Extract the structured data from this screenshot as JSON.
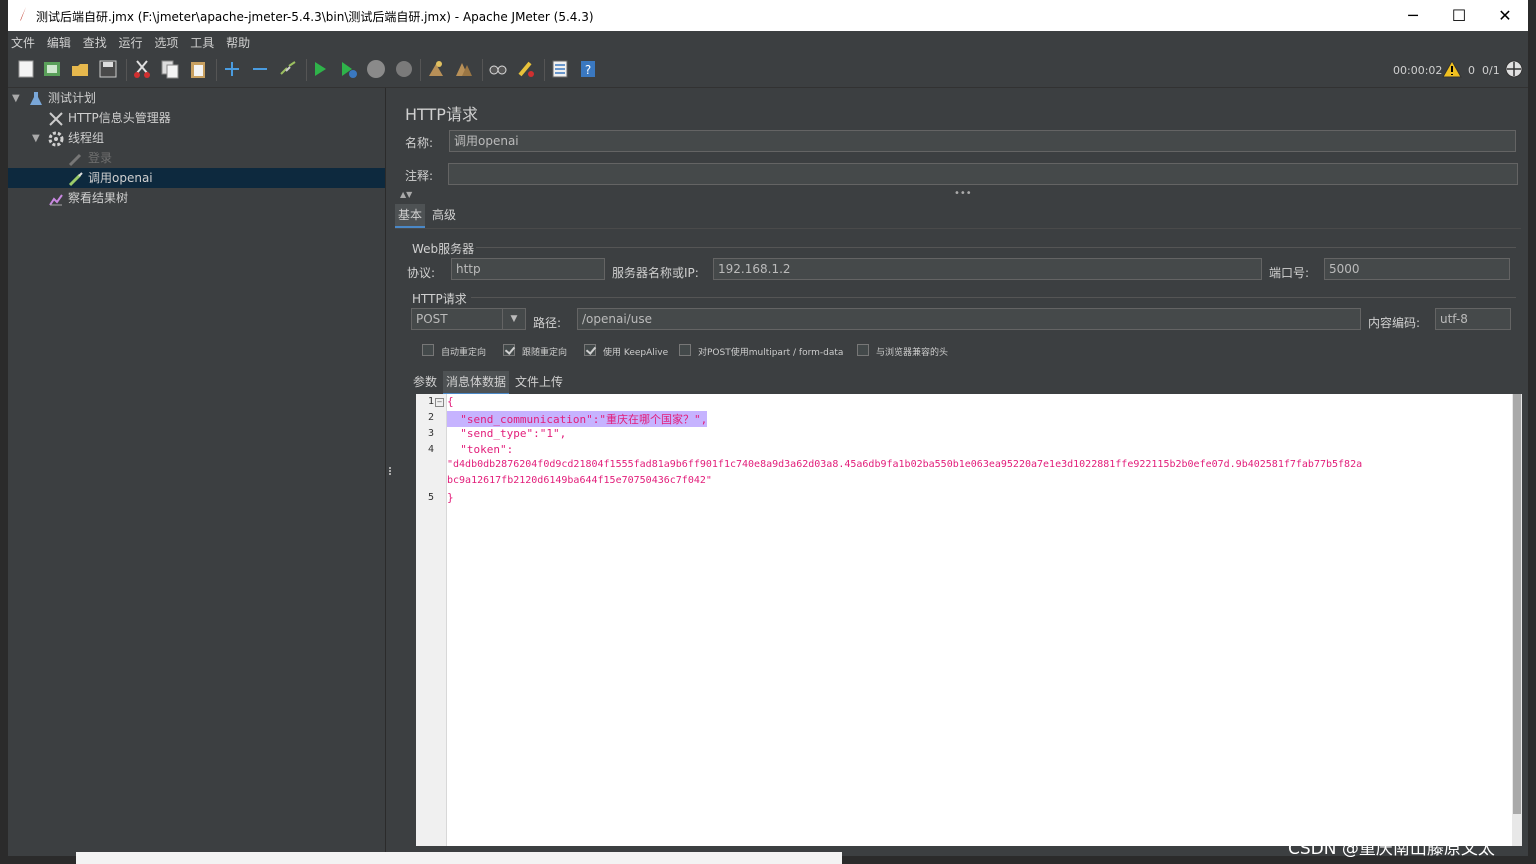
{
  "window": {
    "title": "测试后端自研.jmx (F:\\jmeter\\apache-jmeter-5.4.3\\bin\\测试后端自研.jmx) - Apache JMeter (5.4.3)",
    "minimize": "─",
    "maximize": "☐",
    "close": "✕"
  },
  "menu": [
    "文件",
    "编辑",
    "查找",
    "运行",
    "选项",
    "工具",
    "帮助"
  ],
  "status": {
    "elapsed": "00:00:02",
    "warnings": "0",
    "threads": "0/1"
  },
  "tree": {
    "test_plan": "测试计划",
    "header_manager": "HTTP信息头管理器",
    "thread_group": "线程组",
    "login": "登录",
    "call_openai": "调用openai",
    "results_tree": "察看结果树"
  },
  "panel": {
    "title": "HTTP请求",
    "name_label": "名称:",
    "name_value": "调用openai",
    "comment_label": "注释:",
    "comment_value": "",
    "tabs": [
      "基本",
      "高级"
    ],
    "web_server": "Web服务器",
    "protocol_label": "协议:",
    "protocol": "http",
    "server_label": "服务器名称或IP:",
    "server": "192.168.1.2",
    "port_label": "端口号:",
    "port": "5000",
    "http_request": "HTTP请求",
    "method": "POST",
    "path_label": "路径:",
    "path": "/openai/use",
    "encoding_label": "内容编码:",
    "encoding": "utf-8",
    "checkboxes": [
      {
        "label": "自动重定向",
        "checked": false
      },
      {
        "label": "跟随重定向",
        "checked": true
      },
      {
        "label": "使用 KeepAlive",
        "checked": true
      },
      {
        "label": "对POST使用multipart / form-data",
        "checked": false
      },
      {
        "label": "与浏览器兼容的头",
        "checked": false
      }
    ],
    "body_tabs": [
      "参数",
      "消息体数据",
      "文件上传"
    ]
  },
  "editor": {
    "line_numbers": [
      "1",
      "2",
      "3",
      "4",
      "",
      "",
      "5"
    ],
    "lines": [
      "{",
      "  \"send_communication\":\"重庆在哪个国家？\",",
      "  \"send_type\":\"1\",",
      "  \"token\":",
      "\"d4db0db2876204f0d9cd21804f1555fad81a9b6ff901f1c740e8a9d3a62d03a8.45a6db9fa1b02ba550b1e063ea95220a7e1e3d1022881ffe922115b2b0efe07d.9b402581f7fab77b5f82a",
      "bc9a12617fb2120d6149ba644f15e70750436c7f042\"",
      "}"
    ]
  },
  "watermark": "CSDN @重庆南山藤原文太"
}
